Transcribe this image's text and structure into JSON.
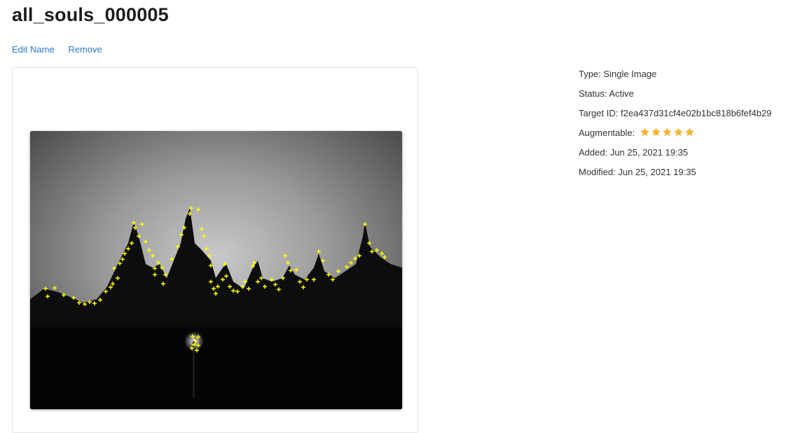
{
  "target": {
    "name": "all_souls_000005"
  },
  "actions": {
    "edit_label": "Edit Name",
    "remove_label": "Remove"
  },
  "details": {
    "type_label": "Type:",
    "type_value": "Single Image",
    "status_label": "Status:",
    "status_value": "Active",
    "target_id_label": "Target ID:",
    "target_id_value": "f2ea437d31cf4e02b1bc818b6fef4b29",
    "augmentable_label": "Augmentable:",
    "augmentable_rating": 5,
    "augmentable_max": 5,
    "added_label": "Added:",
    "added_value": "Jun 25, 2021 19:35",
    "modified_label": "Modified:",
    "modified_value": "Jun 25, 2021 19:35"
  },
  "colors": {
    "link": "#2a7ad6",
    "star": "#f5b43a",
    "feature_marker": "#ffff00"
  },
  "preview": {
    "icon": "feature-points-overlay"
  }
}
